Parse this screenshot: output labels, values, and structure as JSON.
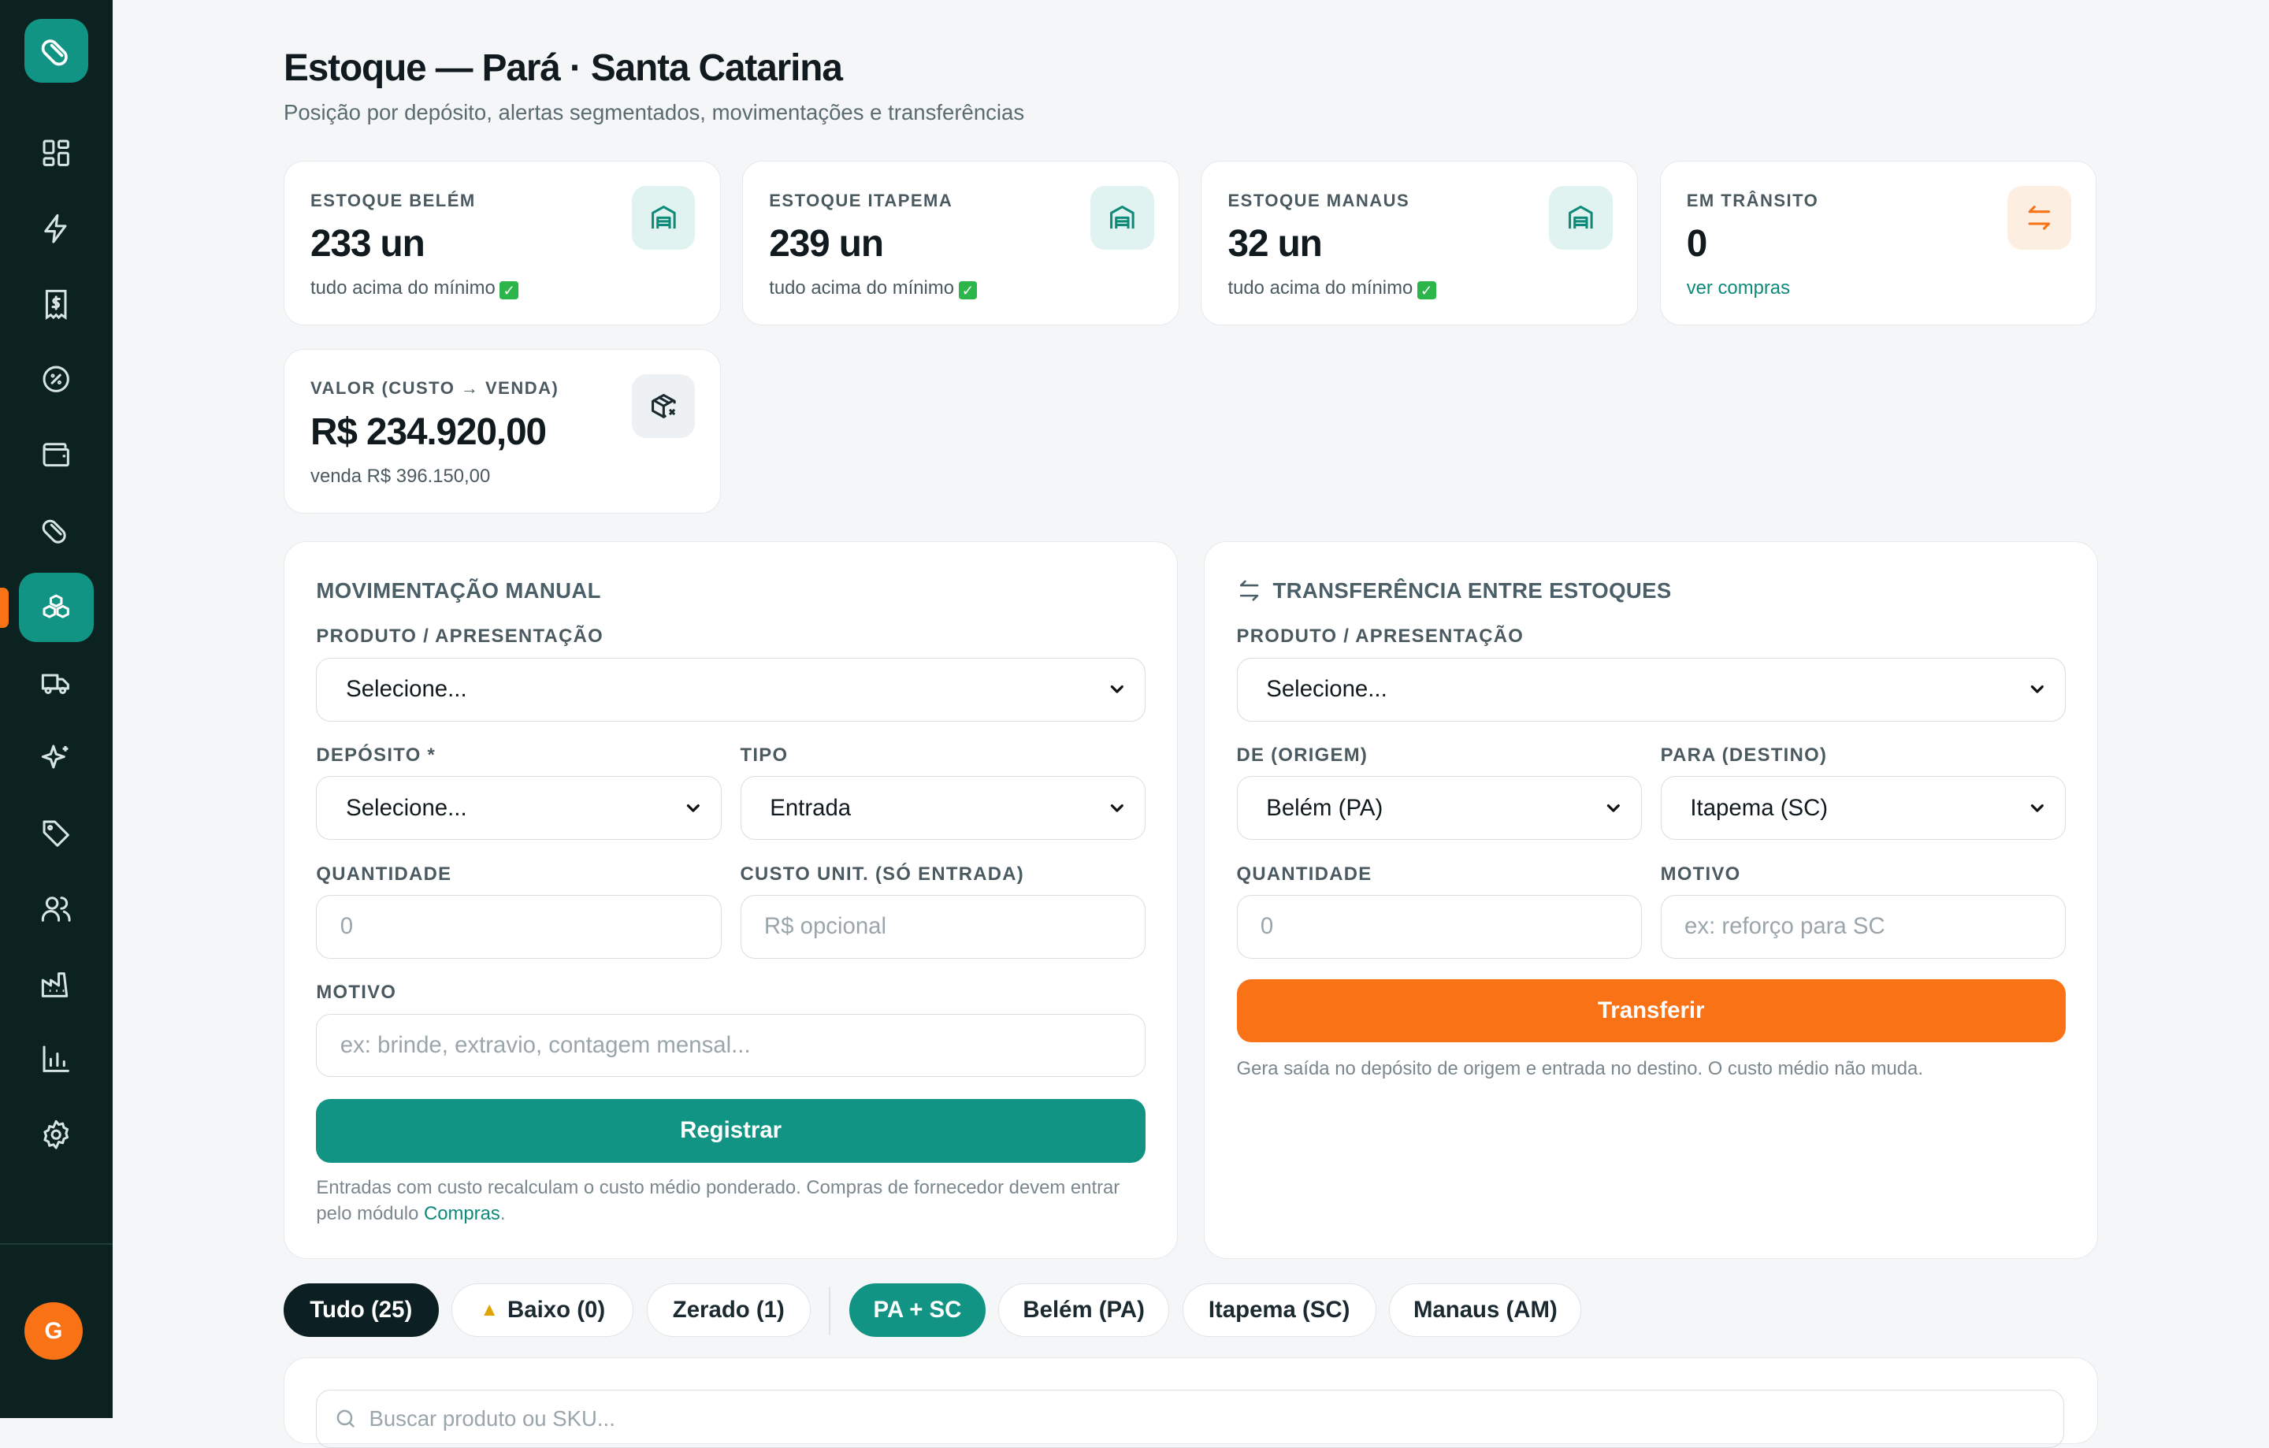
{
  "header": {
    "title": "Estoque — Pará · Santa Catarina",
    "subtitle": "Posição por depósito, alertas segmentados, movimentações e transferências"
  },
  "sidebar": {
    "avatar_initial": "G",
    "items": [
      "dashboard-icon",
      "zap-icon",
      "receipt-icon",
      "badge-percent-icon",
      "wallet-icon",
      "pill-icon",
      "boxes-icon",
      "truck-icon",
      "sparkles-icon",
      "tag-icon",
      "users-icon",
      "factory-icon",
      "bar-chart-icon",
      "settings-icon"
    ],
    "active": "boxes-icon"
  },
  "kpis": [
    {
      "label": "ESTOQUE BELÉM",
      "value": "233 un",
      "note": "tudo acima do mínimo"
    },
    {
      "label": "ESTOQUE ITAPEMA",
      "value": "239 un",
      "note": "tudo acima do mínimo"
    },
    {
      "label": "ESTOQUE MANAUS",
      "value": "32 un",
      "note": "tudo acima do mínimo"
    },
    {
      "label": "EM TRÂNSITO",
      "value": "0",
      "note": "ver compras"
    },
    {
      "label": "VALOR (CUSTO → VENDA)",
      "value": "R$ 234.920,00",
      "note": "venda R$ 396.150,00"
    }
  ],
  "manual": {
    "title": "MOVIMENTAÇÃO MANUAL",
    "product_label": "PRODUTO / APRESENTAÇÃO",
    "product_value": "Selecione...",
    "deposit_label": "DEPÓSITO *",
    "deposit_value": "Selecione...",
    "type_label": "TIPO",
    "type_value": "Entrada",
    "qty_label": "QUANTIDADE",
    "qty_placeholder": "0",
    "cost_label": "CUSTO UNIT. (SÓ ENTRADA)",
    "cost_placeholder": "R$ opcional",
    "reason_label": "MOTIVO",
    "reason_placeholder": "ex: brinde, extravio, contagem mensal...",
    "submit": "Registrar",
    "help_text": "Entradas com custo recalculam o custo médio ponderado. Compras de fornecedor devem entrar pelo módulo",
    "help_link": "Compras",
    "help_end": "."
  },
  "transfer": {
    "title": "TRANSFERÊNCIA ENTRE ESTOQUES",
    "product_label": "PRODUTO / APRESENTAÇÃO",
    "product_value": "Selecione...",
    "from_label": "DE (ORIGEM)",
    "from_value": "Belém (PA)",
    "to_label": "PARA (DESTINO)",
    "to_value": "Itapema (SC)",
    "qty_label": "QUANTIDADE",
    "qty_placeholder": "0",
    "reason_label": "MOTIVO",
    "reason_placeholder": "ex: reforço para SC",
    "submit": "Transferir",
    "help_text": "Gera saída no depósito de origem e entrada no destino. O custo médio não muda."
  },
  "filters": {
    "status": [
      "Tudo (25)",
      "Baixo (0)",
      "Zerado (1)"
    ],
    "deposits": [
      "PA + SC",
      "Belém (PA)",
      "Itapema (SC)",
      "Manaus (AM)"
    ]
  },
  "search": {
    "placeholder": "Buscar produto ou SKU..."
  },
  "colors": {
    "sidebar": "#0c2220",
    "accent_teal": "#129485",
    "accent_orange": "#f97316",
    "background": "#f4f6f7"
  }
}
